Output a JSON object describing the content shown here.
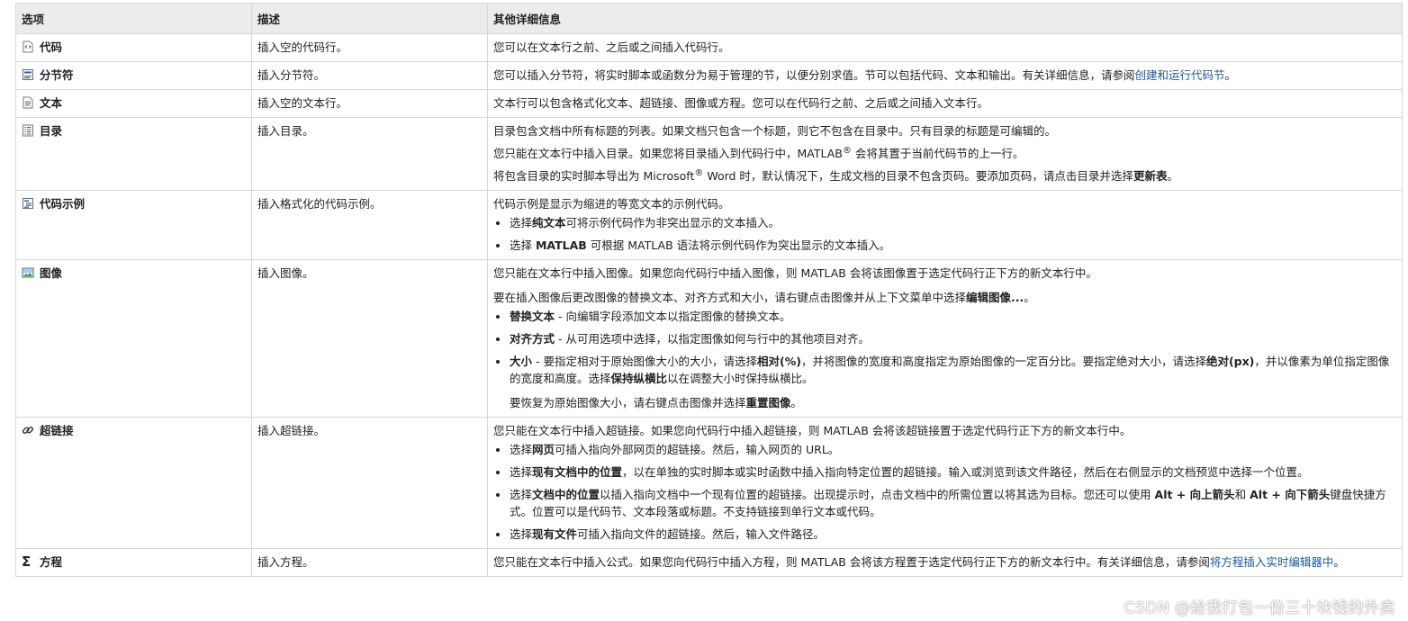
{
  "headers": {
    "option": "选项",
    "description": "描述",
    "details": "其他详细信息"
  },
  "rows": [
    {
      "option": "代码",
      "icon": "code-line-icon",
      "desc": "插入空的代码行。",
      "detail": {
        "p1": "您可以在文本行之前、之后或之间插入代码行。"
      }
    },
    {
      "option": "分节符",
      "icon": "section-break-icon",
      "desc": "插入分节符。",
      "detail": {
        "p1": "您可以插入分节符，将实时脚本或函数分为易于管理的节，以便分别求值。节可以包括代码、文本和输出。有关详细信息，请参阅",
        "link": "创建和运行代码节",
        "p1_end": "。"
      }
    },
    {
      "option": "文本",
      "icon": "text-line-icon",
      "desc": "插入空的文本行。",
      "detail": {
        "p1": "文本行可以包含格式化文本、超链接、图像或方程。您可以在代码行之前、之后或之间插入文本行。"
      }
    },
    {
      "option": "目录",
      "icon": "table-of-contents-icon",
      "desc": "插入目录。",
      "detail": {
        "p1": "目录包含文档中所有标题的列表。如果文档只包含一个标题，则它不包含在目录中。只有目录的标题是可编辑的。",
        "p2a": "您只能在文本行中插入目录。如果您将目录插入到代码行中，MATLAB",
        "p2sup": "®",
        "p2b": " 会将其置于当前代码节的上一行。",
        "p3a": "将包含目录的实时脚本导出为 Microsoft",
        "p3sup": "®",
        "p3b": " Word 时，默认情况下，生成文档的目录不包含页码。要添加页码，请点击目录并选择",
        "p3bold": "更新表",
        "p3c": "。"
      }
    },
    {
      "option": "代码示例",
      "icon": "code-example-icon",
      "desc": "插入格式化的代码示例。",
      "detail": {
        "p1": "代码示例是显示为缩进的等宽文本的示例代码。",
        "b1a": "选择",
        "b1bold": "纯文本",
        "b1b": "可将示例代码作为非突出显示的文本插入。",
        "b2a": "选择 ",
        "b2bold": "MATLAB",
        "b2b": " 可根据 MATLAB 语法将示例代码作为突出显示的文本插入。"
      }
    },
    {
      "option": "图像",
      "icon": "image-icon",
      "desc": "插入图像。",
      "detail": {
        "p1": "您只能在文本行中插入图像。如果您向代码行中插入图像，则 MATLAB 会将该图像置于选定代码行正下方的新文本行中。",
        "p2a": "要在插入图像后更改图像的替换文本、对齐方式和大小，请右键点击图像并从上下文菜单中选择",
        "p2bold": "编辑图像...",
        "p2b": "。",
        "b1bold": "替换文本",
        "b1": " - 向编辑字段添加文本以指定图像的替换文本。",
        "b2bold": "对齐方式",
        "b2": " - 从可用选项中选择，以指定图像如何与行中的其他项目对齐。",
        "b3bold": "大小",
        "b3a": " - 要指定相对于原始图像大小的大小，请选择",
        "b3bold2": "相对(%)",
        "b3b": "，并将图像的宽度和高度指定为原始图像的一定百分比。要指定绝对大小，请选择",
        "b3bold3": "绝对(px)",
        "b3c": "，并以像素为单位指定图像的宽度和高度。选择",
        "b3bold4": "保持纵横比",
        "b3d": "以在调整大小时保持纵横比。",
        "b3p2a": "要恢复为原始图像大小，请右键点击图像并选择",
        "b3p2bold": "重置图像",
        "b3p2b": "。"
      }
    },
    {
      "option": "超链接",
      "icon": "link-icon",
      "desc": "插入超链接。",
      "detail": {
        "p1": "您只能在文本行中插入超链接。如果您向代码行中插入超链接，则 MATLAB 会将该超链接置于选定代码行正下方的新文本行中。",
        "b1a": "选择",
        "b1bold": "网页",
        "b1b": "可插入指向外部网页的超链接。然后，输入网页的 URL。",
        "b2a": "选择",
        "b2bold": "现有文档中的位置",
        "b2b": "，以在单独的实时脚本或实时函数中插入指向特定位置的超链接。输入或浏览到该文件路径，然后在右侧显示的文档预览中选择一个位置。",
        "b3a": "选择",
        "b3bold": "文档中的位置",
        "b3b": "以插入指向文档中一个现有位置的超链接。出现提示时，点击文档中的所需位置以将其选为目标。您还可以使用 ",
        "b3bold2": "Alt + 向上箭头",
        "b3c": "和 ",
        "b3bold3": "Alt + 向下箭头",
        "b3d": "键盘快捷方式。位置可以是代码节、文本段落或标题。不支持链接到单行文本或代码。",
        "b4a": "选择",
        "b4bold": "现有文件",
        "b4b": "可插入指向文件的超链接。然后，输入文件路径。"
      }
    },
    {
      "option": "方程",
      "icon": "sigma-icon",
      "desc": "插入方程。",
      "detail": {
        "p1": "您只能在文本行中插入公式。如果您向代码行中插入方程，则 MATLAB 会将该方程置于选定代码行正下方的新文本行中。有关详细信息，请参阅",
        "link": "将方程插入实时编辑器中",
        "p1_end": "。"
      }
    }
  ],
  "watermark": "CSDN @给我打包一份三十块钱的外卖"
}
